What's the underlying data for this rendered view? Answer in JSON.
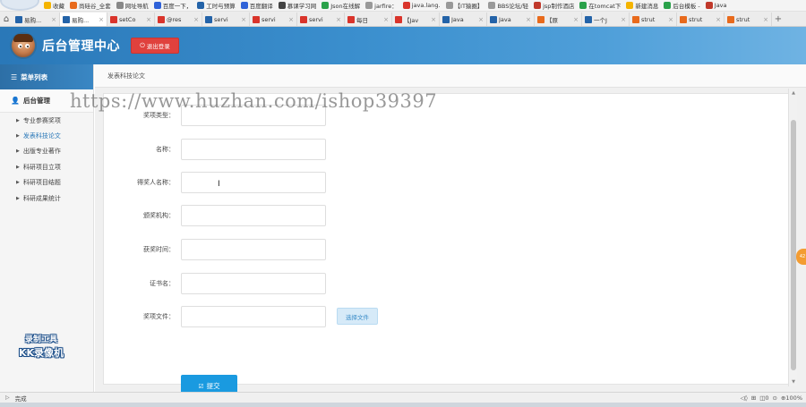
{
  "browser": {
    "bookmarks": [
      {
        "label": "收藏",
        "color": "#f5b400"
      },
      {
        "label": "尚硅谷_全套",
        "color": "#e86a1c"
      },
      {
        "label": "网址导航",
        "color": "#888888"
      },
      {
        "label": "百度一下，",
        "color": "#2f62d8"
      },
      {
        "label": "工时与预算",
        "color": "#2463a8"
      },
      {
        "label": "百度翻译",
        "color": "#2f62d8"
      },
      {
        "label": "慕课学习网",
        "color": "#444444"
      },
      {
        "label": "Json在线解",
        "color": "#2aa14a"
      },
      {
        "label": "jarfire：",
        "color": "#999999"
      },
      {
        "label": "java.lang.",
        "color": "#d9342b"
      },
      {
        "label": "【IT猿圈】",
        "color": "#999999"
      },
      {
        "label": "BBS论坛/轻",
        "color": "#999999"
      },
      {
        "label": "jsp制作酒店",
        "color": "#c0392b"
      },
      {
        "label": "在tomcat下",
        "color": "#2aa14a"
      },
      {
        "label": "新建消息",
        "color": "#f5b400"
      },
      {
        "label": "后台模板 -",
        "color": "#2aa14a"
      },
      {
        "label": "Java",
        "color": "#c0392b"
      }
    ],
    "home_glyph": "⌂",
    "add_tab_glyph": "+",
    "tabs": [
      {
        "label": "易购...",
        "color": "#2463a8",
        "active": false
      },
      {
        "label": "易购...",
        "color": "#2463a8",
        "active": true
      },
      {
        "label": "setCo",
        "color": "#d9342b",
        "active": false
      },
      {
        "label": "@res",
        "color": "#d9342b",
        "active": false
      },
      {
        "label": "servi",
        "color": "#2463a8",
        "active": false
      },
      {
        "label": "servi",
        "color": "#d9342b",
        "active": false
      },
      {
        "label": "servi",
        "color": "#d9342b",
        "active": false
      },
      {
        "label": "每日",
        "color": "#d9342b",
        "active": false
      },
      {
        "label": "【Jav",
        "color": "#d9342b",
        "active": false
      },
      {
        "label": "Java",
        "color": "#2463a8",
        "active": false
      },
      {
        "label": "Java",
        "color": "#2463a8",
        "active": false
      },
      {
        "label": "【原",
        "color": "#e86a1c",
        "active": false
      },
      {
        "label": "一个J",
        "color": "#2463a8",
        "active": false
      },
      {
        "label": "strut",
        "color": "#e86a1c",
        "active": false
      },
      {
        "label": "strut",
        "color": "#e86a1c",
        "active": false
      },
      {
        "label": "strut",
        "color": "#e86a1c",
        "active": false
      }
    ],
    "close_glyph": "×",
    "status_text": "完成",
    "status_right": [
      "◁◊",
      "⊞",
      "◫0",
      "⊙",
      "⊕100%"
    ]
  },
  "header": {
    "title": "后台管理中心",
    "logout_label": "退出登录",
    "logout_icon": "power-icon"
  },
  "sidebar": {
    "menu_title": "菜单列表",
    "group_title": "后台管理",
    "items": [
      {
        "label": "专业参赛奖项",
        "active": false
      },
      {
        "label": "发表科技论文",
        "active": true
      },
      {
        "label": "出版专业著作",
        "active": false
      },
      {
        "label": "科研项目立项",
        "active": false
      },
      {
        "label": "科研项目结题",
        "active": false
      },
      {
        "label": "科研成果统计",
        "active": false
      }
    ]
  },
  "main": {
    "breadcrumb": "发表科技论文",
    "form": {
      "fields": [
        {
          "label": "奖项类型：",
          "value": ""
        },
        {
          "label": "名称：",
          "value": ""
        },
        {
          "label": "得奖人名称：",
          "value": ""
        },
        {
          "label": "颁奖机构：",
          "value": ""
        },
        {
          "label": "获奖时间：",
          "value": ""
        },
        {
          "label": "证书名：",
          "value": ""
        },
        {
          "label": "奖项文件：",
          "value": ""
        }
      ],
      "file_button_label": "选择文件",
      "submit_label": "提交"
    }
  },
  "watermarks": {
    "url_text": "https://www.huzhan.com/ishop39397",
    "recorder_line1": "录制工具",
    "recorder_line2": "KK录像机",
    "edge_badge": "42"
  },
  "colors": {
    "accent": "#2a78b8",
    "logout": "#e0413d",
    "submit": "#1a9ae0"
  }
}
